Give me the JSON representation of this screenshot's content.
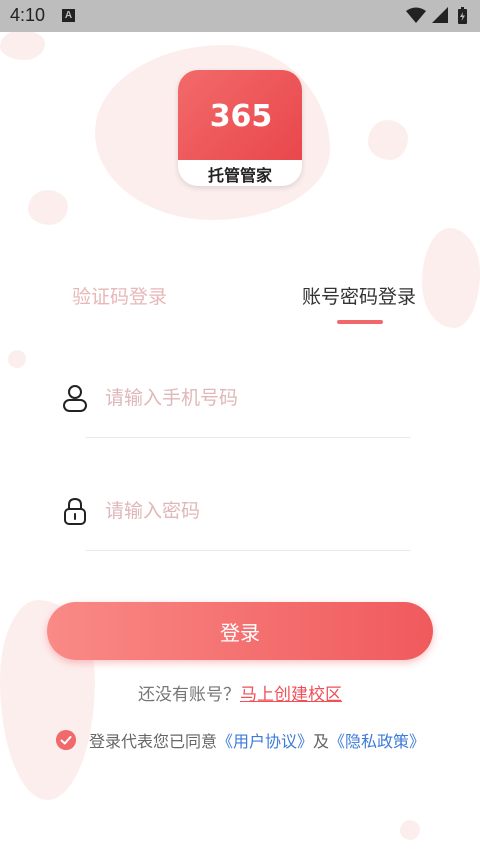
{
  "status_bar": {
    "time": "4:10",
    "notification_letter": "A",
    "icons": [
      "wifi-icon",
      "signal-icon",
      "battery-icon"
    ]
  },
  "logo": {
    "number": "365",
    "name": "托管管家",
    "brand_color": "#ea4d50"
  },
  "tabs": {
    "sms_login": "验证码登录",
    "password_login": "账号密码登录",
    "active": "password_login"
  },
  "form": {
    "phone_placeholder": "请输入手机号码",
    "phone_value": "",
    "password_placeholder": "请输入密码",
    "password_value": ""
  },
  "login_button": "登录",
  "register": {
    "question": "还没有账号？",
    "link": "马上创建校区"
  },
  "agreement": {
    "checked": true,
    "prefix": "登录代表您已同意",
    "user_agreement": "《用户协议》",
    "and": "及",
    "privacy_policy": "《隐私政策》"
  },
  "colors": {
    "accent": "#f05a5d",
    "link": "#3d7bd9"
  }
}
